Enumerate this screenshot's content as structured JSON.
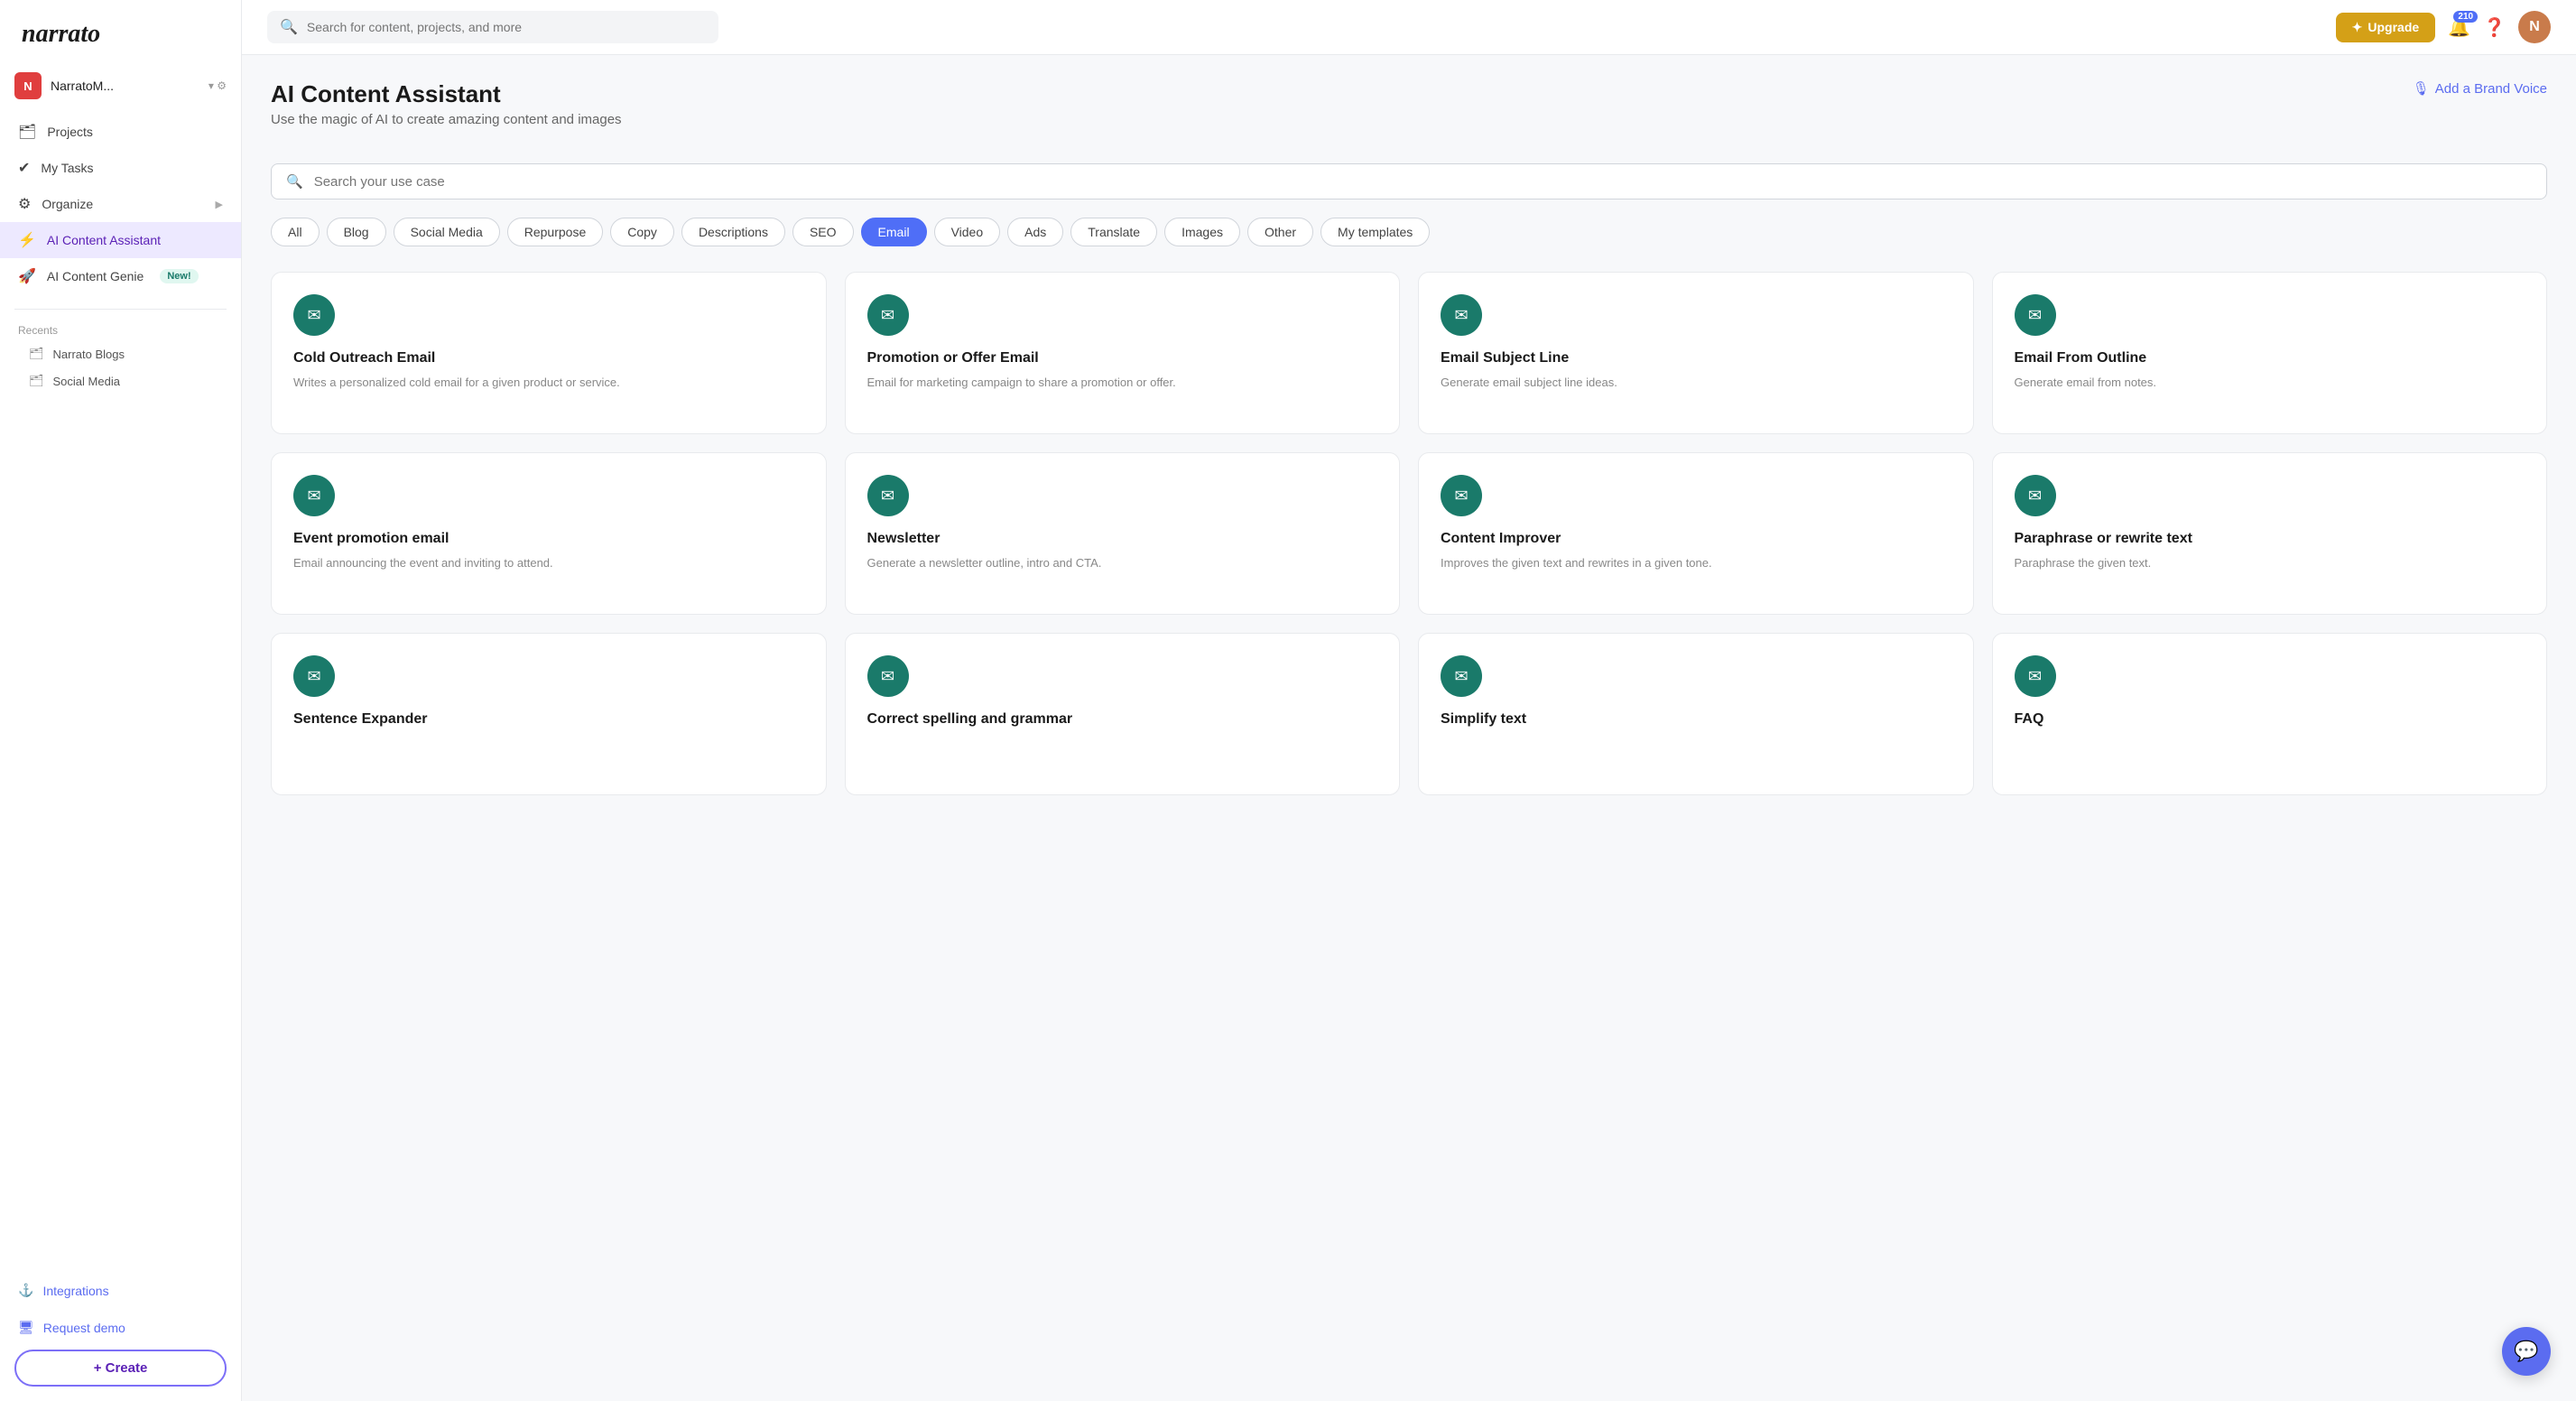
{
  "sidebar": {
    "logo": "narrato",
    "org": {
      "initial": "N",
      "name": "NarratoM...",
      "bg": "#e03e3e"
    },
    "nav_items": [
      {
        "id": "projects",
        "icon": "🗂",
        "label": "Projects"
      },
      {
        "id": "my-tasks",
        "icon": "✔",
        "label": "My Tasks"
      },
      {
        "id": "organize",
        "icon": "⚙",
        "label": "Organize",
        "has_arrow": true
      },
      {
        "id": "ai-content-assistant",
        "icon": "⚡",
        "label": "AI Content Assistant",
        "active": true
      },
      {
        "id": "ai-content-genie",
        "icon": "🚀",
        "label": "AI Content Genie",
        "has_new": true
      }
    ],
    "recents_label": "Recents",
    "recents": [
      {
        "id": "narrato-blogs",
        "icon": "🗂",
        "label": "Narrato Blogs"
      },
      {
        "id": "social-media",
        "icon": "🗂",
        "label": "Social Media"
      }
    ],
    "bottom_links": [
      {
        "id": "integrations",
        "icon": "⚓",
        "label": "Integrations"
      },
      {
        "id": "request-demo",
        "icon": "🖥",
        "label": "Request demo"
      }
    ],
    "create_label": "+ Create"
  },
  "topbar": {
    "search_placeholder": "Search for content, projects, and more",
    "upgrade_label": "Upgrade",
    "notification_count": "210",
    "help_icon": "?",
    "avatar_initial": "N"
  },
  "page": {
    "title": "AI Content Assistant",
    "subtitle": "Use the magic of AI to create amazing content and images",
    "brand_voice_label": "Add a Brand Voice",
    "template_search_placeholder": "Search your use case"
  },
  "filters": [
    {
      "id": "all",
      "label": "All",
      "active": false
    },
    {
      "id": "blog",
      "label": "Blog",
      "active": false
    },
    {
      "id": "social-media",
      "label": "Social Media",
      "active": false
    },
    {
      "id": "repurpose",
      "label": "Repurpose",
      "active": false
    },
    {
      "id": "copy",
      "label": "Copy",
      "active": false
    },
    {
      "id": "descriptions",
      "label": "Descriptions",
      "active": false
    },
    {
      "id": "seo",
      "label": "SEO",
      "active": false
    },
    {
      "id": "email",
      "label": "Email",
      "active": true
    },
    {
      "id": "video",
      "label": "Video",
      "active": false
    },
    {
      "id": "ads",
      "label": "Ads",
      "active": false
    },
    {
      "id": "translate",
      "label": "Translate",
      "active": false
    },
    {
      "id": "images",
      "label": "Images",
      "active": false
    },
    {
      "id": "other",
      "label": "Other",
      "active": false
    },
    {
      "id": "my-templates",
      "label": "My templates",
      "active": false
    }
  ],
  "cards": [
    {
      "id": "cold-outreach-email",
      "title": "Cold Outreach Email",
      "desc": "Writes a personalized cold email for a given product or service.",
      "icon": "✉"
    },
    {
      "id": "promotion-offer-email",
      "title": "Promotion or Offer Email",
      "desc": "Email for marketing campaign to share a promotion or offer.",
      "icon": "✉"
    },
    {
      "id": "email-subject-line",
      "title": "Email Subject Line",
      "desc": "Generate email subject line ideas.",
      "icon": "✉"
    },
    {
      "id": "email-from-outline",
      "title": "Email From Outline",
      "desc": "Generate email from notes.",
      "icon": "✉"
    },
    {
      "id": "event-promotion-email",
      "title": "Event promotion email",
      "desc": "Email announcing the event and inviting to attend.",
      "icon": "✉"
    },
    {
      "id": "newsletter",
      "title": "Newsletter",
      "desc": "Generate a newsletter outline, intro and CTA.",
      "icon": "✉"
    },
    {
      "id": "content-improver",
      "title": "Content Improver",
      "desc": "Improves the given text and rewrites in a given tone.",
      "icon": "✉"
    },
    {
      "id": "paraphrase-rewrite",
      "title": "Paraphrase or rewrite text",
      "desc": "Paraphrase the given text.",
      "icon": "✉"
    },
    {
      "id": "sentence-expander",
      "title": "Sentence Expander",
      "desc": "",
      "icon": "✉"
    },
    {
      "id": "correct-spelling-grammar",
      "title": "Correct spelling and grammar",
      "desc": "",
      "icon": "✉"
    },
    {
      "id": "simplify-text",
      "title": "Simplify text",
      "desc": "",
      "icon": "✉"
    },
    {
      "id": "faq",
      "title": "FAQ",
      "desc": "",
      "icon": "✉"
    }
  ]
}
